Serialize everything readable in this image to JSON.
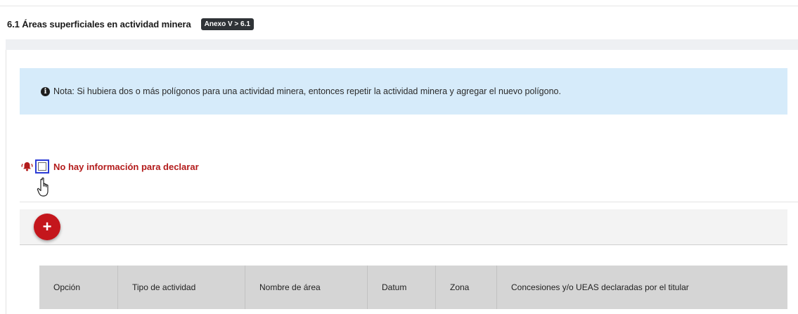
{
  "section": {
    "title": "6.1 Áreas superficiales en actividad minera",
    "annex_badge": "Anexo V > 6.1"
  },
  "note": {
    "icon": "info-circle-icon",
    "text": "Nota: Si hubiera dos o más polígonos para una actividad minera, entonces repetir la actividad minera y agregar el nuevo polígono."
  },
  "no_info": {
    "icon": "bell-alert-icon",
    "label": "No hay información para declarar",
    "checked": false
  },
  "toolbar": {
    "add_label": "+"
  },
  "table": {
    "columns": [
      "Opción",
      "Tipo de actividad",
      "Nombre de área",
      "Datum",
      "Zona",
      "Concesiones y/o UEAS declaradas por el titular"
    ]
  },
  "colors": {
    "accent_red": "#c4161c",
    "note_bg": "#d6ebfa",
    "header_bg": "#d5d5d5",
    "focus_blue": "#2b3bd6"
  }
}
